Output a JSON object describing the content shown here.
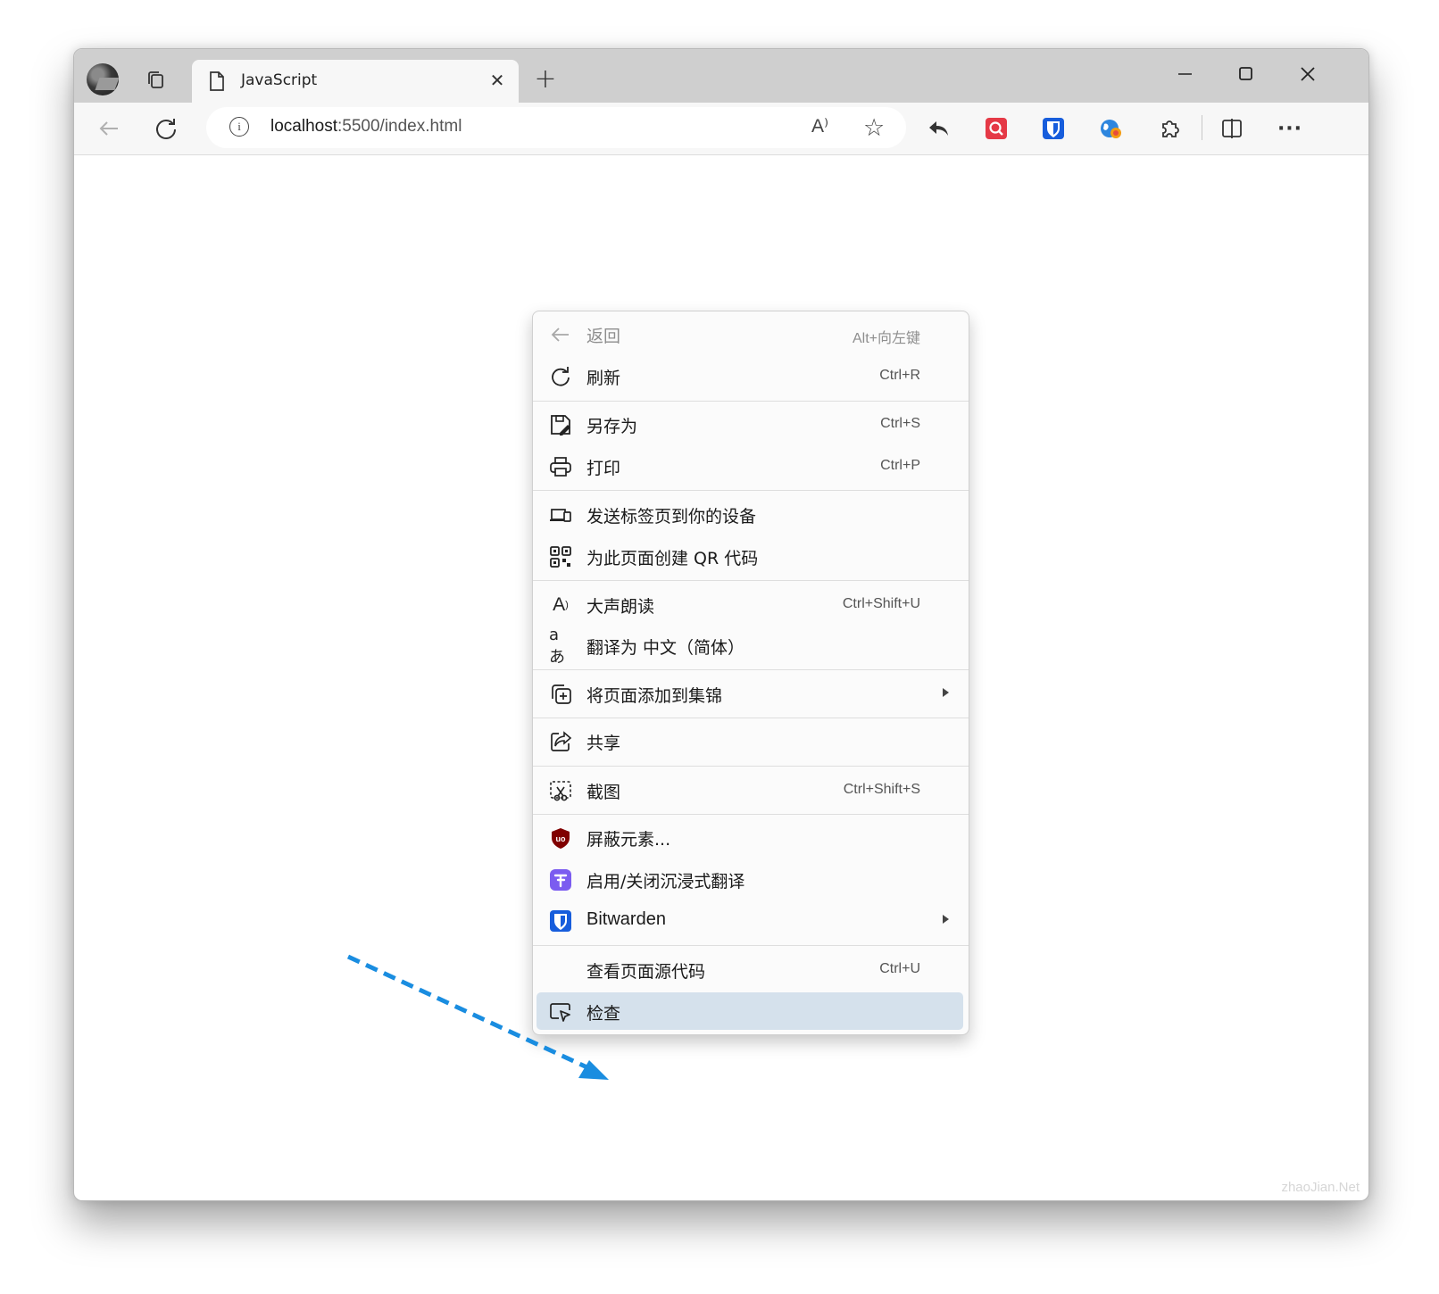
{
  "tab": {
    "title": "JavaScript",
    "close_glyph": "✕"
  },
  "new_tab_glyph": "+",
  "address": {
    "host": "localhost",
    "rest": ":5500/index.html",
    "info_glyph": "i",
    "read_aloud_glyph": "A⁾",
    "favorite_glyph": "☆"
  },
  "toolbar_icons": [
    "back-arrow-icon",
    "refresh-icon",
    "reply-icon",
    "search-extension-icon",
    "bitwarden-icon",
    "translate-extension-icon",
    "extensions-icon",
    "split-screen-icon",
    "more-icon"
  ],
  "more_glyph": "···",
  "menu": {
    "items": [
      {
        "label": "返回",
        "shortcut": "Alt+向左键",
        "icon": "back-arrow-icon",
        "disabled": true
      },
      {
        "label": "刷新",
        "shortcut": "Ctrl+R",
        "icon": "refresh-icon"
      },
      {
        "label": "另存为",
        "shortcut": "Ctrl+S",
        "icon": "save-as-icon"
      },
      {
        "label": "打印",
        "shortcut": "Ctrl+P",
        "icon": "printer-icon"
      },
      {
        "label": "发送标签页到你的设备",
        "shortcut": "",
        "icon": "send-to-device-icon"
      },
      {
        "label": "为此页面创建 QR 代码",
        "shortcut": "",
        "icon": "qr-code-icon"
      },
      {
        "label": "大声朗读",
        "shortcut": "Ctrl+Shift+U",
        "icon": "read-aloud-icon"
      },
      {
        "label": "翻译为 中文（简体）",
        "shortcut": "",
        "icon": "translate-icon"
      },
      {
        "label": "将页面添加到集锦",
        "shortcut": "",
        "icon": "collections-add-icon",
        "submenu": true
      },
      {
        "label": "共享",
        "shortcut": "",
        "icon": "share-icon"
      },
      {
        "label": "截图",
        "shortcut": "Ctrl+Shift+S",
        "icon": "screenshot-icon"
      },
      {
        "label": "屏蔽元素...",
        "shortcut": "",
        "icon": "ublock-icon"
      },
      {
        "label": "启用/关闭沉浸式翻译",
        "shortcut": "",
        "icon": "immersive-translate-icon"
      },
      {
        "label": "Bitwarden",
        "shortcut": "",
        "icon": "bitwarden-icon",
        "submenu": true
      },
      {
        "label": "查看页面源代码",
        "shortcut": "Ctrl+U",
        "icon": ""
      },
      {
        "label": "检查",
        "shortcut": "",
        "icon": "inspect-icon",
        "highlighted": true
      }
    ]
  },
  "watermark": "zhaoJian.Net",
  "colors": {
    "arrow": "#1a8de0",
    "highlight": "#d5e1ec",
    "bitwarden": "#175ddc",
    "ublock": "#800000",
    "immersive": "#7b5cf0",
    "search_ext": "#e53946"
  }
}
